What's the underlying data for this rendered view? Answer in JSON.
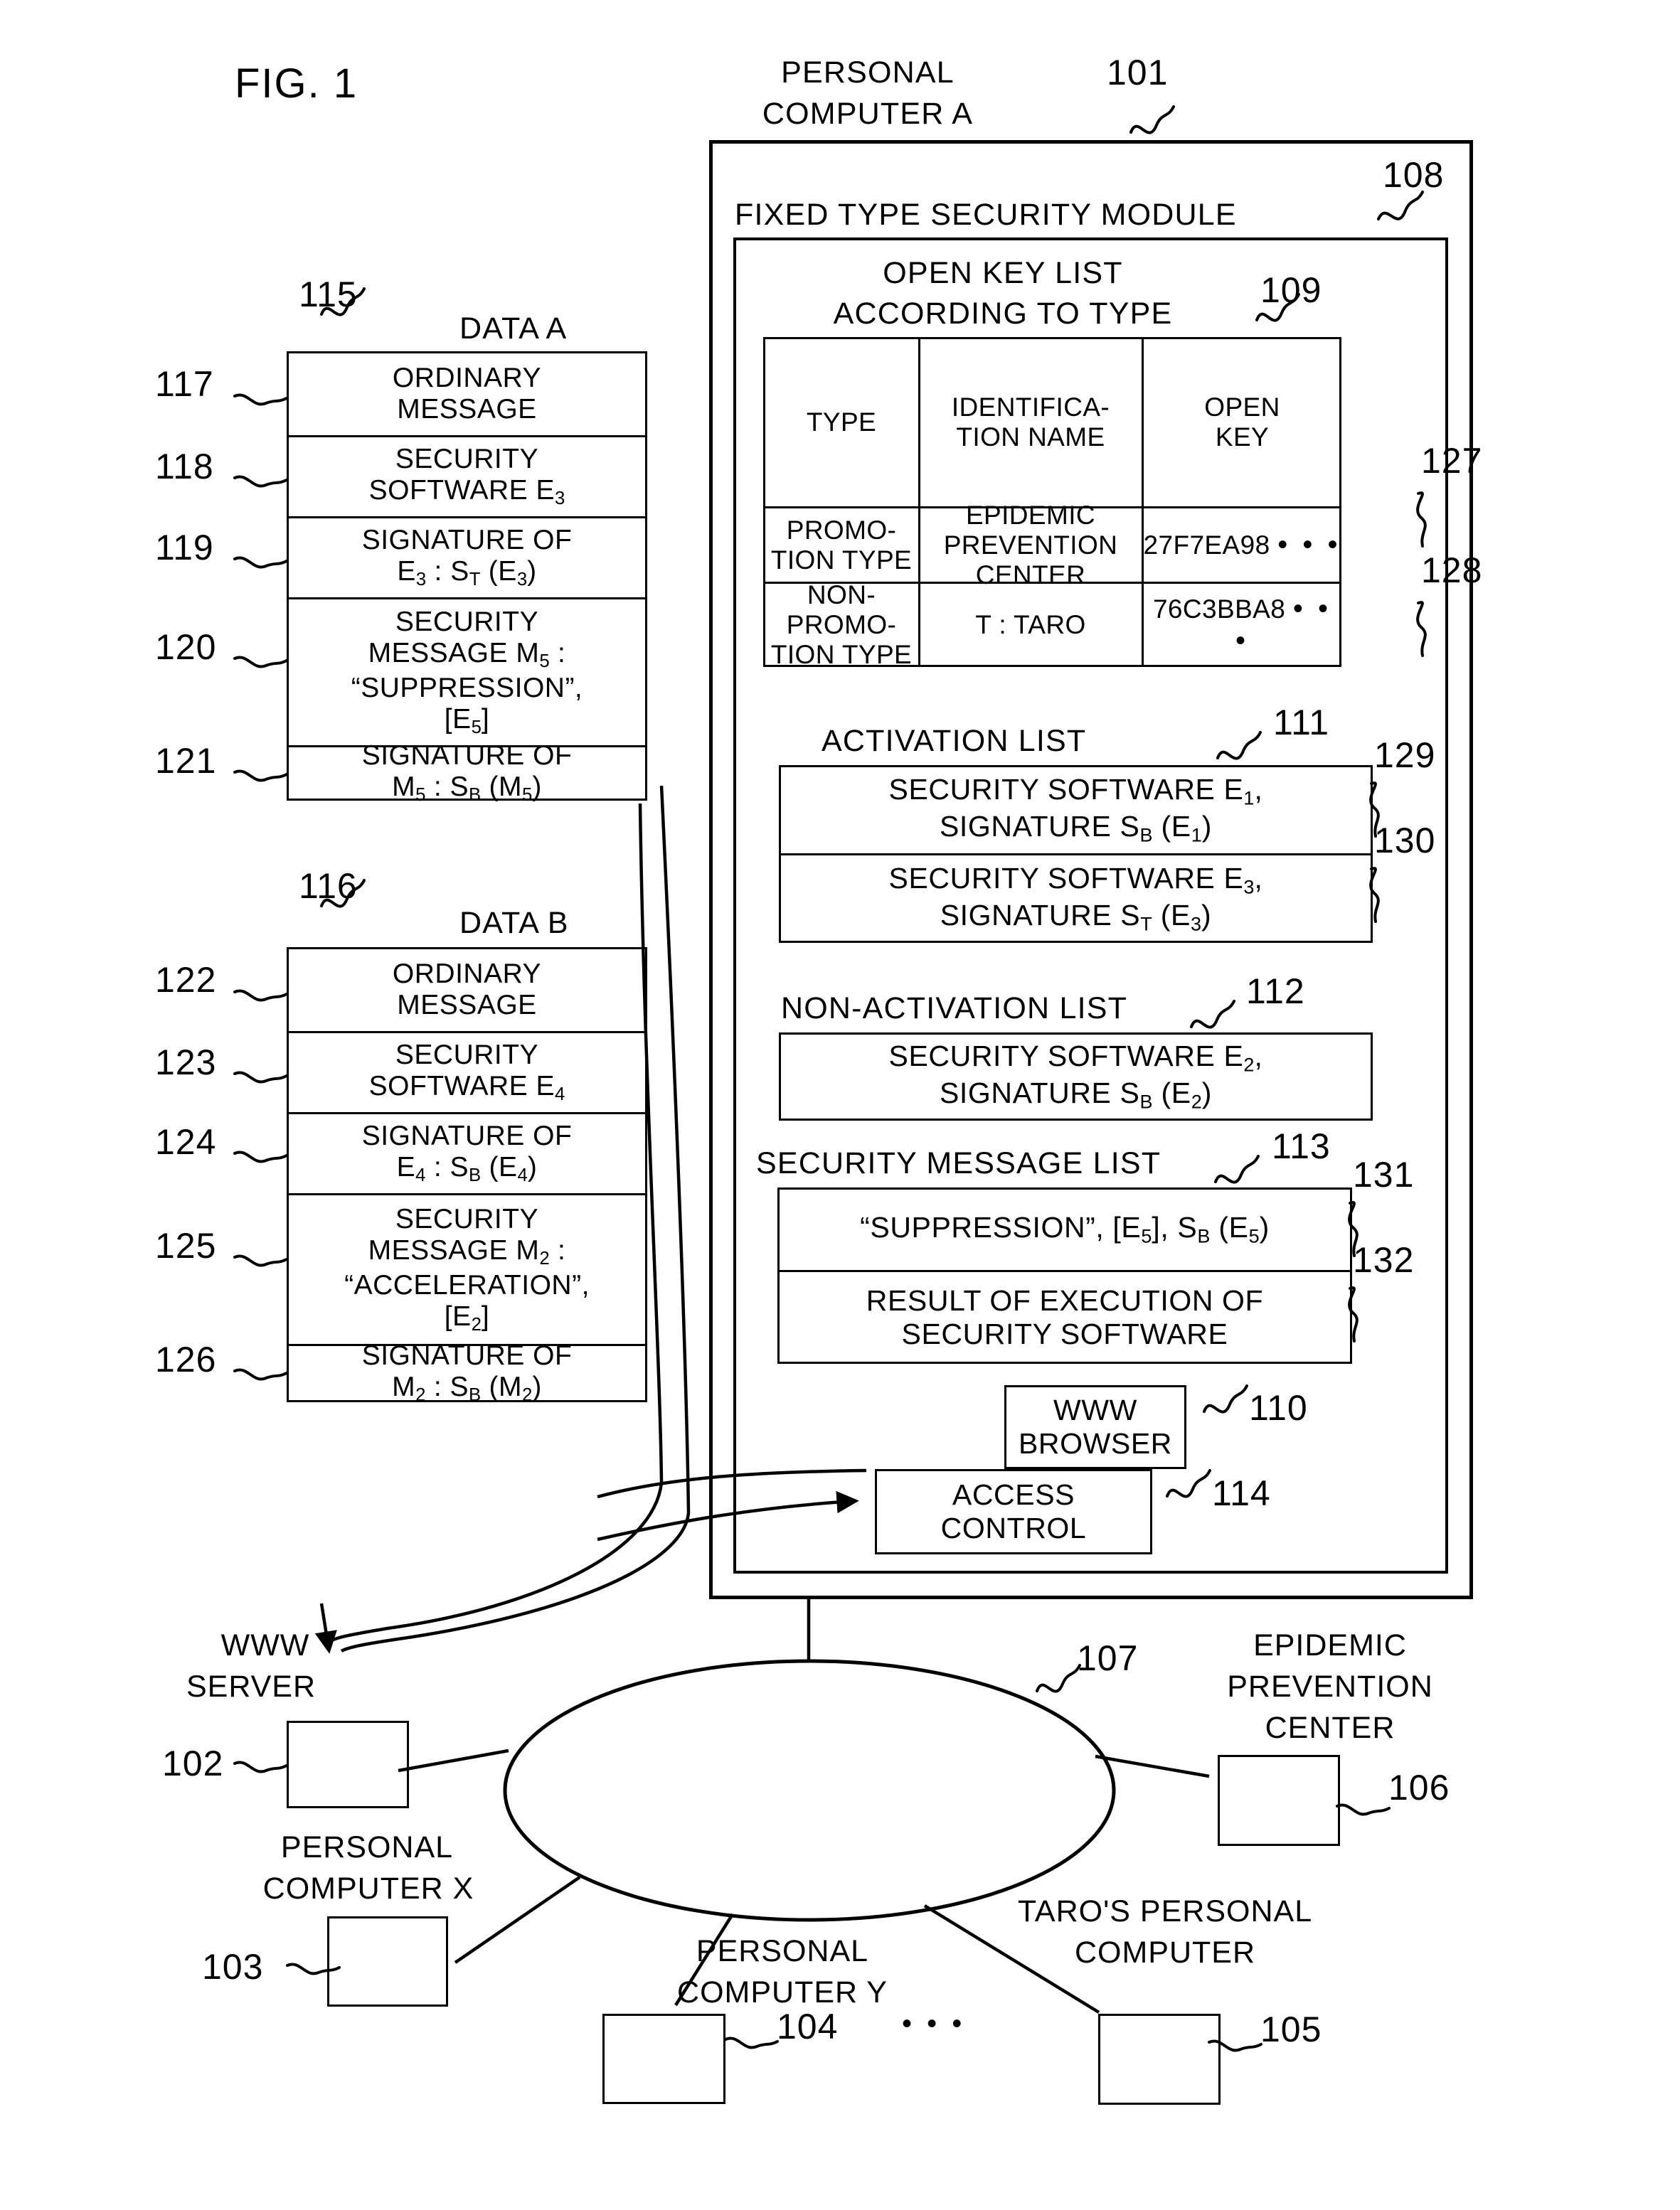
{
  "figure": {
    "label": "FIG. 1"
  },
  "personal_computer_a": {
    "title_line1": "PERSONAL",
    "title_line2": "COMPUTER A",
    "ref": "101"
  },
  "security_module": {
    "title": "FIXED TYPE SECURITY MODULE",
    "ref": "108"
  },
  "open_key_list": {
    "title_line1": "OPEN KEY LIST",
    "title_line2": "ACCORDING TO TYPE",
    "ref": "109",
    "headers": [
      "TYPE",
      "IDENTIFICA-\nTION NAME",
      "OPEN\nKEY"
    ],
    "rows": [
      {
        "ref": "127",
        "type": "PROMO-\nTION TYPE",
        "identification_name": "EPIDEMIC\nPREVENTION\nCENTER",
        "open_key": "27F7EA98"
      },
      {
        "ref": "128",
        "type": "NON-\nPROMO-\nTION TYPE",
        "identification_name": "T : TARO",
        "open_key": "76C3BBA8"
      }
    ],
    "key_ellipsis": "• • •"
  },
  "activation_list": {
    "title": "ACTIVATION LIST",
    "ref": "111",
    "items": [
      {
        "ref": "129",
        "line1": "SECURITY SOFTWARE E",
        "sub1": "1",
        "line1_tail": ",",
        "line2": "SIGNATURE S",
        "sub2": "B",
        "line2_tail": " (E",
        "sub3": "1",
        "line2_end": ")"
      },
      {
        "ref": "130",
        "line1": "SECURITY SOFTWARE E",
        "sub1": "3",
        "line1_tail": ",",
        "line2": "SIGNATURE S",
        "sub2": "T",
        "line2_tail": " (E",
        "sub3": "3",
        "line2_end": ")"
      }
    ]
  },
  "non_activation_list": {
    "title": "NON-ACTIVATION LIST",
    "ref": "112",
    "items": [
      {
        "line1": "SECURITY SOFTWARE E",
        "sub1": "2",
        "line1_tail": ",",
        "line2": "SIGNATURE S",
        "sub2": "B",
        "line2_tail": " (E",
        "sub3": "2",
        "line2_end": ")"
      }
    ]
  },
  "security_message_list": {
    "title": "SECURITY MESSAGE LIST",
    "ref": "113",
    "items": [
      {
        "ref": "131",
        "kind": "suppression",
        "prefix": "“SUPPRESSION”, [E",
        "sub1": "5",
        "mid": "], S",
        "sub2": "B",
        "tail": " (E",
        "sub3": "5",
        "end": ")"
      },
      {
        "ref": "132",
        "kind": "plain",
        "line1": "RESULT OF EXECUTION OF",
        "line2": "SECURITY SOFTWARE"
      }
    ]
  },
  "www_browser": {
    "line1": "WWW",
    "line2": "BROWSER",
    "ref": "110"
  },
  "access_control": {
    "line1": "ACCESS",
    "line2": "CONTROL",
    "ref": "114"
  },
  "data_a": {
    "title": "DATA A",
    "ref": "115",
    "rows": [
      {
        "ref": "117",
        "line1": "ORDINARY",
        "line2": "MESSAGE"
      },
      {
        "ref": "118",
        "line1": "SECURITY",
        "line2": "SOFTWARE E",
        "sub2": "3"
      },
      {
        "ref": "119",
        "line1": "SIGNATURE OF",
        "line2": "E",
        "sub_a": "3",
        "line2_mid": " : S",
        "sub_b": "T",
        "line2_tail": " (E",
        "sub_c": "3",
        "line2_end": ")"
      },
      {
        "ref": "120",
        "line1": "SECURITY",
        "line2": "MESSAGE M",
        "sub2": "5",
        "line2_tail": " :",
        "line3": "“SUPPRESSION”,",
        "line4": "[E",
        "sub4": "5",
        "line4_tail": "]"
      },
      {
        "ref": "121",
        "line1": "SIGNATURE OF",
        "line2": "M",
        "sub_a": "5",
        "line2_mid": " : S",
        "sub_b": "B",
        "line2_tail": " (M",
        "sub_c": "5",
        "line2_end": ")"
      }
    ]
  },
  "data_b": {
    "title": "DATA B",
    "ref": "116",
    "rows": [
      {
        "ref": "122",
        "line1": "ORDINARY",
        "line2": "MESSAGE"
      },
      {
        "ref": "123",
        "line1": "SECURITY",
        "line2": "SOFTWARE E",
        "sub2": "4"
      },
      {
        "ref": "124",
        "line1": "SIGNATURE OF",
        "line2": "E",
        "sub_a": "4",
        "line2_mid": " : S",
        "sub_b": "B",
        "line2_tail": " (E",
        "sub_c": "4",
        "line2_end": ")"
      },
      {
        "ref": "125",
        "line1": "SECURITY",
        "line2": "MESSAGE M",
        "sub2": "2",
        "line2_tail": " :",
        "line3": "“ACCELERATION”,",
        "line4": "[E",
        "sub4": "2",
        "line4_tail": "]"
      },
      {
        "ref": "126",
        "line1": "SIGNATURE OF",
        "line2": "M",
        "sub_a": "2",
        "line2_mid": " : S",
        "sub_b": "B",
        "line2_tail": " (M",
        "sub_c": "2",
        "line2_end": ")"
      }
    ]
  },
  "network": {
    "cloud_ref": "107",
    "nodes": [
      {
        "id": "www-server",
        "line1": "WWW",
        "line2": "SERVER",
        "ref": "102"
      },
      {
        "id": "personal-computer-x",
        "line1": "PERSONAL",
        "line2": "COMPUTER X",
        "ref": "103"
      },
      {
        "id": "personal-computer-y",
        "line1": "PERSONAL",
        "line2": "COMPUTER Y",
        "ref": "104"
      },
      {
        "id": "taros-personal-computer",
        "line1": "TARO'S PERSONAL",
        "line2": "COMPUTER",
        "ref": "105"
      },
      {
        "id": "epidemic-prevention-center",
        "line1": "EPIDEMIC",
        "line2": "PREVENTION",
        "line3": "CENTER",
        "ref": "106"
      }
    ],
    "ellipsis": "• • •"
  }
}
